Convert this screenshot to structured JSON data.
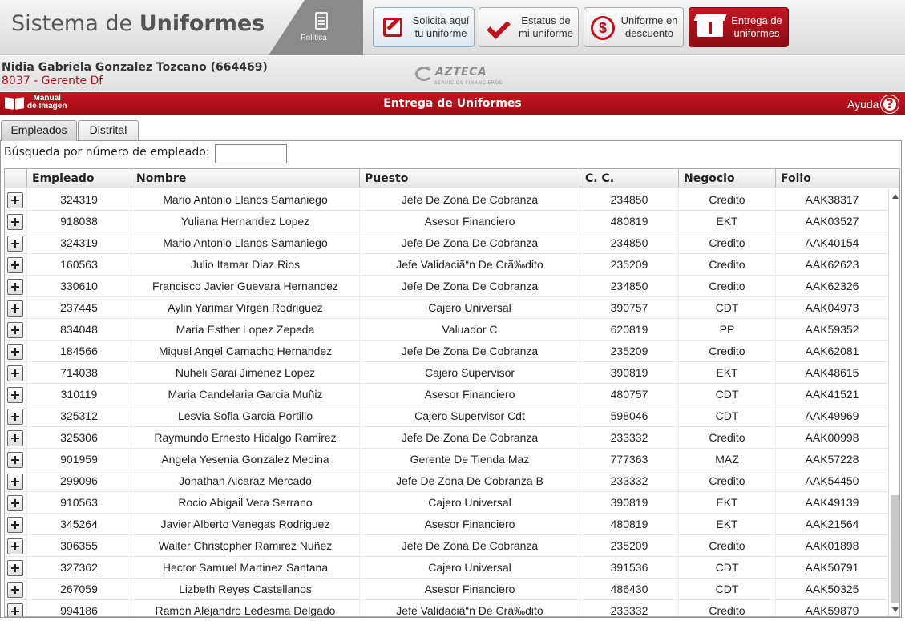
{
  "header": {
    "brand_prefix": "Sistema de",
    "brand_bold": "Uniformes",
    "policy_label": "Política",
    "nav": [
      {
        "label": "Solicita aquí tu uniforme",
        "icon": "edit-icon"
      },
      {
        "label": "Estatus de mi uniforme",
        "icon": "check-icon"
      },
      {
        "label": "Uniforme en descuento",
        "icon": "dollar-icon"
      },
      {
        "label": "Entrega de uniformes",
        "icon": "box-icon"
      }
    ]
  },
  "user": {
    "name": "Nidia Gabriela Gonzalez Tozcano (664469)",
    "role": "8037 - Gerente Df",
    "logo_name": "AZTECA",
    "logo_sub": "SERVICIOS FINANCIEROS"
  },
  "titlebar": {
    "manual_line1": "Manual",
    "manual_line2": "de Imagen",
    "title": "Entrega de Uniformes",
    "help": "Ayuda",
    "help_symbol": "?"
  },
  "tabs": [
    "Empleados",
    "Distrital"
  ],
  "search": {
    "label": "Búsqueda por número de empleado:",
    "value": ""
  },
  "table": {
    "columns": [
      "",
      "Empleado",
      "Nombre",
      "Puesto",
      "C. C.",
      "Negocio",
      "Folio"
    ],
    "rows": [
      [
        "324319",
        "Mario Antonio Llanos Samaniego",
        "Jefe De Zona De Cobranza",
        "234850",
        "Credito",
        "AAK38317"
      ],
      [
        "918038",
        "Yuliana Hernandez Lopez",
        "Asesor Financiero",
        "480819",
        "EKT",
        "AAK03527"
      ],
      [
        "324319",
        "Mario Antonio Llanos Samaniego",
        "Jefe De Zona De Cobranza",
        "234850",
        "Credito",
        "AAK40154"
      ],
      [
        "160563",
        "Julio Itamar Diaz Rios",
        "Jefe Validaciã“n De Crã‰dito",
        "235209",
        "Credito",
        "AAK62623"
      ],
      [
        "330610",
        "Francisco Javier Guevara Hernandez",
        "Jefe De Zona De Cobranza",
        "234850",
        "Credito",
        "AAK62326"
      ],
      [
        "237445",
        "Aylin Yarimar Virgen Rodriguez",
        "Cajero Universal",
        "390757",
        "CDT",
        "AAK04973"
      ],
      [
        "834048",
        "Maria Esther Lopez Zepeda",
        "Valuador C",
        "620819",
        "PP",
        "AAK59352"
      ],
      [
        "184566",
        "Miguel Angel Camacho Hernandez",
        "Jefe De Zona De Cobranza",
        "235209",
        "Credito",
        "AAK62081"
      ],
      [
        "714038",
        "Nuheli Sarai Jimenez Lopez",
        "Cajero Supervisor",
        "390819",
        "EKT",
        "AAK48615"
      ],
      [
        "310119",
        "Maria Candelaria Garcia Muñiz",
        "Asesor Financiero",
        "480757",
        "CDT",
        "AAK41521"
      ],
      [
        "325312",
        "Lesvia Sofia Garcia Portillo",
        "Cajero Supervisor Cdt",
        "598046",
        "CDT",
        "AAK49969"
      ],
      [
        "325306",
        "Raymundo Ernesto Hidalgo Ramirez",
        "Jefe De Zona De Cobranza",
        "233332",
        "Credito",
        "AAK00998"
      ],
      [
        "901959",
        "Angela Yesenia Gonzalez Medina",
        "Gerente De Tienda Maz",
        "777363",
        "MAZ",
        "AAK57228"
      ],
      [
        "299096",
        "Jonathan Alcaraz Mercado",
        "Jefe De Zona De Cobranza B",
        "233332",
        "Credito",
        "AAK54450"
      ],
      [
        "910563",
        "Rocio Abigail Vera Serrano",
        "Cajero Universal",
        "390819",
        "EKT",
        "AAK49139"
      ],
      [
        "345264",
        "Javier Alberto Venegas Rodriguez",
        "Asesor Financiero",
        "480819",
        "EKT",
        "AAK21564"
      ],
      [
        "306355",
        "Walter Christopher Ramirez Nuñez",
        "Jefe De Zona De Cobranza",
        "235209",
        "Credito",
        "AAK01898"
      ],
      [
        "327362",
        "Hector Samuel Martinez Santana",
        "Cajero Universal",
        "391536",
        "CDT",
        "AAK50791"
      ],
      [
        "267059",
        "Lizbeth Reyes Castellanos",
        "Asesor Financiero",
        "486430",
        "CDT",
        "AAK50325"
      ],
      [
        "994186",
        "Ramon Alejandro Ledesma Delgado",
        "Jefe Validaciã“n De Crã‰dito",
        "233332",
        "Credito",
        "AAK59879"
      ]
    ]
  },
  "colors": {
    "brand_red": "#c0121d",
    "active_nav": "#a50f19"
  }
}
